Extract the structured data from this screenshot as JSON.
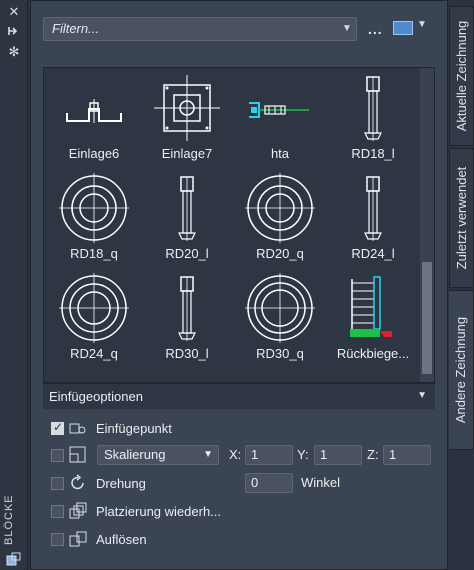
{
  "left_strip": {
    "title": "BLÖCKE",
    "icons": [
      "close-icon",
      "pin-icon",
      "settings-icon",
      "block-icon"
    ]
  },
  "toolbar": {
    "filter_placeholder": "Filtern...",
    "more_label": "...",
    "view_icon": "thumbnail-view-icon"
  },
  "blocks": [
    {
      "label": "Einlage6",
      "icon": "einlage6-block-icon"
    },
    {
      "label": "Einlage7",
      "icon": "einlage7-block-icon"
    },
    {
      "label": "hta",
      "icon": "hta-block-icon"
    },
    {
      "label": "RD18_l",
      "icon": "rd18-l-block-icon"
    },
    {
      "label": "RD18_q",
      "icon": "rd18-q-block-icon"
    },
    {
      "label": "RD20_l",
      "icon": "rd20-l-block-icon"
    },
    {
      "label": "RD20_q",
      "icon": "rd20-q-block-icon"
    },
    {
      "label": "RD24_l",
      "icon": "rd24-l-block-icon"
    },
    {
      "label": "RD24_q",
      "icon": "rd24-q-block-icon"
    },
    {
      "label": "RD30_l",
      "icon": "rd30-l-block-icon"
    },
    {
      "label": "RD30_q",
      "icon": "rd30-q-block-icon"
    },
    {
      "label": "Rückbiege...",
      "icon": "rueckbiege-block-icon"
    }
  ],
  "options": {
    "header": "Einfügeoptionen",
    "insertion_point": {
      "label": "Einfügepunkt",
      "checked": true
    },
    "scale": {
      "selected": "Skalierung",
      "x_label": "X:",
      "x": "1",
      "y_label": "Y:",
      "y": "1",
      "z_label": "Z:",
      "z": "1",
      "checked": false
    },
    "rotation": {
      "label": "Drehung",
      "value": "0",
      "unit": "Winkel",
      "checked": false
    },
    "repeat": {
      "label": "Platzierung wiederh...",
      "checked": false
    },
    "explode": {
      "label": "Auflösen",
      "checked": false
    }
  },
  "tabs": [
    {
      "label": "Aktuelle Zeichnung",
      "active": false
    },
    {
      "label": "Zuletzt verwendet",
      "active": false
    },
    {
      "label": "Andere Zeichnung",
      "active": true
    }
  ],
  "colors": {
    "panel": "#3b4453",
    "grid_bg": "#2e3543",
    "accent": "#4f8ad1"
  }
}
